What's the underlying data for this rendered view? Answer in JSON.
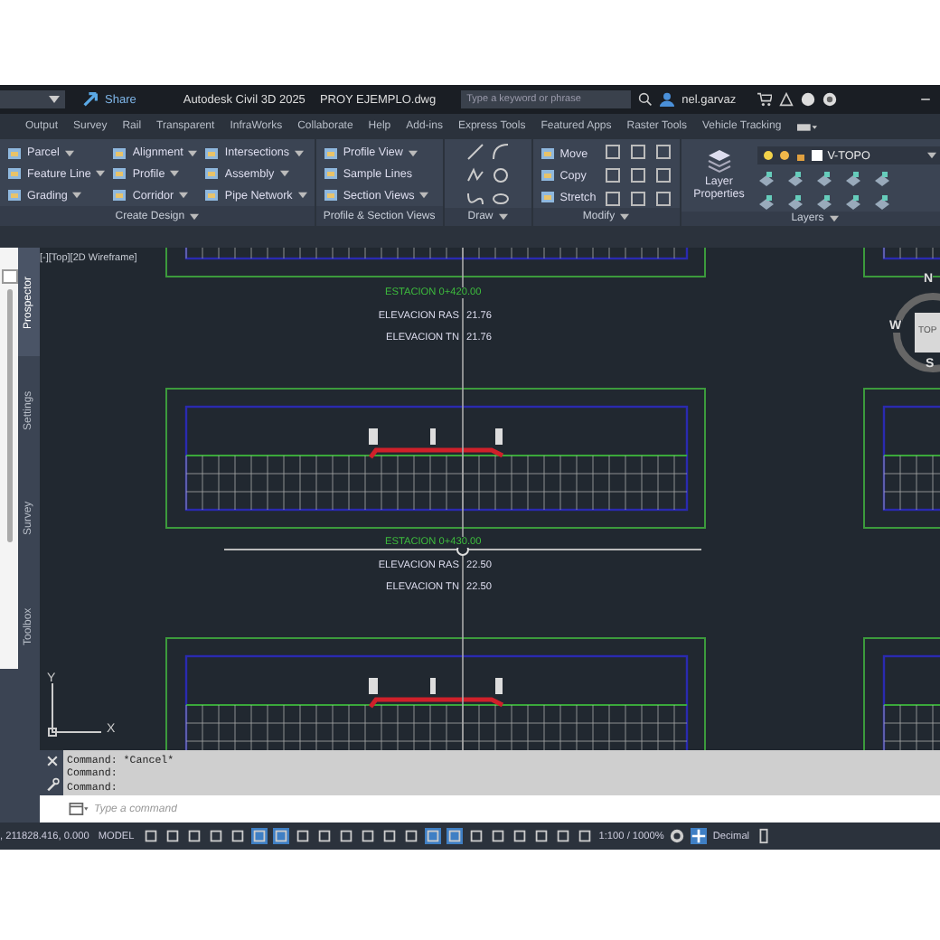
{
  "title_bar": {
    "share": "Share",
    "title": "Autodesk Civil 3D 2025",
    "file": "PROY EJEMPLO.dwg",
    "search": {
      "placeholder": "Type a keyword or phrase"
    },
    "user": "nel.garvaz"
  },
  "ribbon_tabs": [
    {
      "label": "Output",
      "selected": false
    },
    {
      "label": "Survey",
      "selected": false
    },
    {
      "label": "Rail",
      "selected": false
    },
    {
      "label": "Transparent",
      "selected": false
    },
    {
      "label": "InfraWorks",
      "selected": false
    },
    {
      "label": "Collaborate",
      "selected": false
    },
    {
      "label": "Help",
      "selected": false
    },
    {
      "label": "Add-ins",
      "selected": false
    },
    {
      "label": "Express Tools",
      "selected": false
    },
    {
      "label": "Featured Apps",
      "selected": false
    },
    {
      "label": "Raster Tools",
      "selected": false
    },
    {
      "label": "Vehicle Tracking",
      "selected": false
    }
  ],
  "ribbon_panels": [
    {
      "title": "Create Design",
      "dropdown": true,
      "kind": "tools",
      "columns": [
        [
          {
            "label": "Parcel",
            "dropdown": true
          },
          {
            "label": "Feature Line",
            "dropdown": true
          },
          {
            "label": "Grading",
            "dropdown": true
          }
        ],
        [
          {
            "label": "Alignment",
            "dropdown": true
          },
          {
            "label": "Profile",
            "dropdown": true
          },
          {
            "label": "Corridor",
            "dropdown": true
          }
        ],
        [
          {
            "label": "Intersections",
            "dropdown": true
          },
          {
            "label": "Assembly",
            "dropdown": true
          },
          {
            "label": "Pipe Network",
            "dropdown": true
          }
        ]
      ]
    },
    {
      "title": "Profile & Section Views",
      "dropdown": false,
      "kind": "tools",
      "columns": [
        [
          {
            "label": "Profile View",
            "dropdown": true
          },
          {
            "label": "Sample Lines",
            "dropdown": false
          },
          {
            "label": "Section Views",
            "dropdown": true
          }
        ]
      ]
    },
    {
      "title": "Draw",
      "dropdown": true,
      "kind": "draw"
    },
    {
      "title": "Modify",
      "dropdown": true,
      "kind": "modify",
      "columns": [
        [
          {
            "label": "Move",
            "dropdown": false
          },
          {
            "label": "Copy",
            "dropdown": false
          },
          {
            "label": "Stretch",
            "dropdown": false
          }
        ]
      ]
    },
    {
      "title": "Layers",
      "dropdown": true,
      "kind": "layers",
      "button": "Layer Properties",
      "layer": "V-TOPO"
    }
  ],
  "viewport_label": "[-][Top][2D Wireframe]",
  "palette_tabs": [
    {
      "label": "Prospector",
      "selected": true
    },
    {
      "label": "Settings",
      "selected": false
    },
    {
      "label": "Survey",
      "selected": false
    },
    {
      "label": "Toolbox",
      "selected": false
    }
  ],
  "stations": [
    {
      "title": "ESTACION 0+420.00",
      "rows": [
        {
          "label": "ELEVACION RAS",
          "value": "21.76"
        },
        {
          "label": "ELEVACION TN",
          "value": "21.76"
        }
      ]
    },
    {
      "title": "ESTACION 0+430.00",
      "rows": [
        {
          "label": "ELEVACION RAS",
          "value": "22.50"
        },
        {
          "label": "ELEVACION TN",
          "value": "22.50"
        }
      ]
    }
  ],
  "viewcube": {
    "north": "N",
    "west": "W",
    "south": "S",
    "face": "TOP"
  },
  "ucs": {
    "x": "X",
    "y": "Y"
  },
  "command_history": [
    "Command: *Cancel*",
    "Command:",
    "Command:"
  ],
  "command_input": {
    "placeholder": "Type a command"
  },
  "status_bar": {
    "coordinates": ", 211828.416, 0.000",
    "space": "MODEL",
    "scale": "1:100 / 1000%",
    "units": "Decimal"
  }
}
